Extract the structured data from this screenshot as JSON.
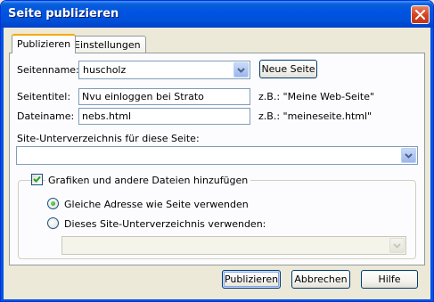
{
  "window": {
    "title": "Seite publizieren"
  },
  "tabs": [
    {
      "label": "Publizieren",
      "active": true
    },
    {
      "label": "Einstellungen",
      "active": false
    }
  ],
  "site": {
    "label": "Seitenname:",
    "value": "huscholz",
    "new_site_button": "Neue Seite"
  },
  "page_title": {
    "label": "Seitentitel:",
    "value": "Nvu einloggen bei Strato",
    "example": "z.B.: \"Meine Web-Seite\""
  },
  "file_name": {
    "label": "Dateiname:",
    "value": "nebs.html",
    "example": "z.B.: \"meineseite.html\""
  },
  "subdir": {
    "label": "Site-Unterverzeichnis für diese Seite:",
    "value": ""
  },
  "include_files": {
    "label": "Grafiken und andere Dateien hinzufügen",
    "checked": true
  },
  "radio_same": {
    "label": "Gleiche Adresse wie Seite verwenden",
    "selected": true
  },
  "radio_subdir": {
    "label": "Dieses Site-Unterverzeichnis verwenden:",
    "selected": false,
    "value": ""
  },
  "buttons": {
    "publish": "Publizieren",
    "cancel": "Abbrechen",
    "help": "Hilfe"
  },
  "colors": {
    "title_bar": "#0054e3",
    "close_button": "#d6441f",
    "tab_highlight": "#f8a800",
    "radio_selected": "#21a121"
  }
}
